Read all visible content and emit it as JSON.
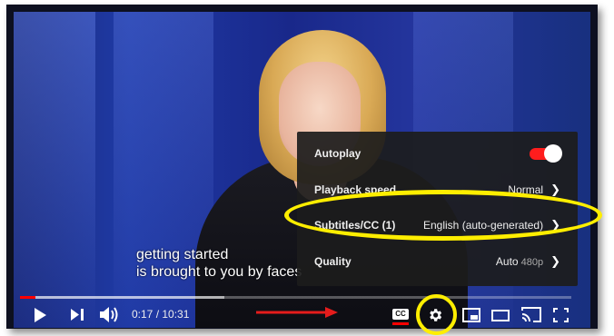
{
  "captions": {
    "line1": "getting started",
    "line2": "is brought to you by faces"
  },
  "settings_menu": {
    "autoplay": {
      "label": "Autoplay",
      "enabled": true
    },
    "playback_speed": {
      "label": "Playback speed",
      "value": "Normal"
    },
    "subtitles": {
      "label": "Subtitles/CC (1)",
      "value": "English (auto-generated)"
    },
    "quality": {
      "label": "Quality",
      "value": "Auto",
      "sub_value": "480p"
    }
  },
  "player": {
    "time_display": "0:17 / 10:31",
    "progress": {
      "played_fraction": 0.028,
      "buffered_fraction": 0.37
    },
    "cc_label": "CC"
  },
  "colors": {
    "accent_red": "#ff0000",
    "annotation_yellow": "#ffee00",
    "menu_bg": "#1c1c1c"
  },
  "icons": [
    "play-icon",
    "next-icon",
    "volume-icon",
    "cc-icon",
    "gear-icon",
    "miniplayer-icon",
    "theater-icon",
    "cast-icon",
    "fullscreen-icon"
  ]
}
